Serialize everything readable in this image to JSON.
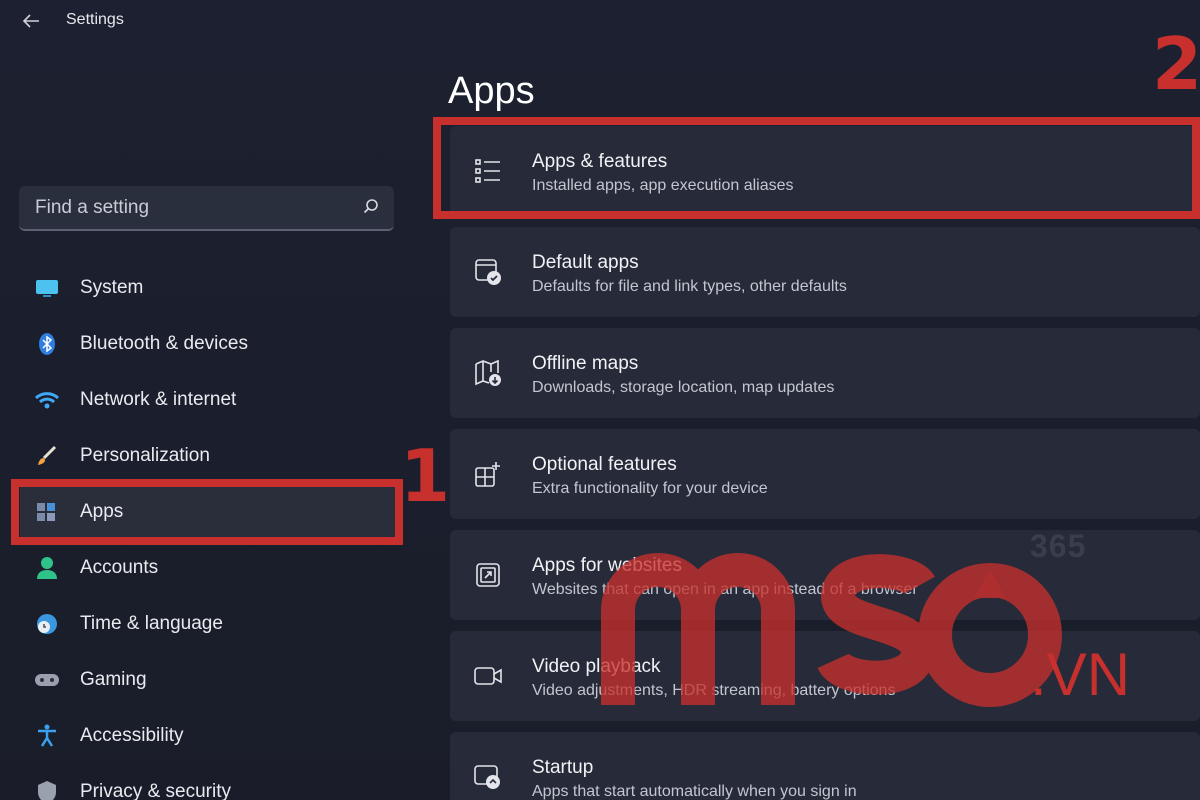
{
  "window": {
    "title": "Settings"
  },
  "search": {
    "placeholder": "Find a setting"
  },
  "sidebar": {
    "items": [
      {
        "label": "System",
        "icon": "monitor-icon"
      },
      {
        "label": "Bluetooth & devices",
        "icon": "bluetooth-icon"
      },
      {
        "label": "Network & internet",
        "icon": "wifi-icon"
      },
      {
        "label": "Personalization",
        "icon": "brush-icon"
      },
      {
        "label": "Apps",
        "icon": "apps-icon",
        "selected": true
      },
      {
        "label": "Accounts",
        "icon": "person-icon"
      },
      {
        "label": "Time & language",
        "icon": "globe-clock-icon"
      },
      {
        "label": "Gaming",
        "icon": "gamepad-icon"
      },
      {
        "label": "Accessibility",
        "icon": "accessibility-icon"
      },
      {
        "label": "Privacy & security",
        "icon": "shield-icon"
      }
    ]
  },
  "main": {
    "title": "Apps",
    "cards": [
      {
        "title": "Apps & features",
        "subtitle": "Installed apps, app execution aliases",
        "icon": "list-icon"
      },
      {
        "title": "Default apps",
        "subtitle": "Defaults for file and link types, other defaults",
        "icon": "default-apps-icon"
      },
      {
        "title": "Offline maps",
        "subtitle": "Downloads, storage location, map updates",
        "icon": "map-download-icon"
      },
      {
        "title": "Optional features",
        "subtitle": "Extra functionality for your device",
        "icon": "grid-add-icon"
      },
      {
        "title": "Apps for websites",
        "subtitle": "Websites that can open in an app instead of a browser",
        "icon": "open-in-app-icon"
      },
      {
        "title": "Video playback",
        "subtitle": "Video adjustments, HDR streaming, battery options",
        "icon": "video-camera-icon"
      },
      {
        "title": "Startup",
        "subtitle": "Apps that start automatically when you sign in",
        "icon": "startup-icon"
      }
    ]
  },
  "annotations": {
    "step1": "1",
    "step2": "2"
  },
  "watermark": {
    "brand": "mso",
    "suffix": ".VN",
    "number": "365"
  },
  "colors": {
    "highlight": "#c8302d",
    "background": "#1b1f2c",
    "card": "#272b39"
  }
}
